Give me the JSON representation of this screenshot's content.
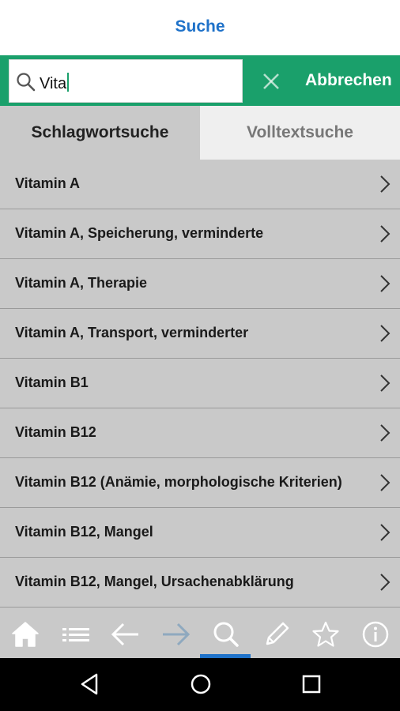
{
  "header": {
    "title": "Suche"
  },
  "search": {
    "value": "Vita",
    "clear_icon": "close-icon",
    "cancel_label": "Abbrechen"
  },
  "tabs": [
    {
      "label": "Schlagwortsuche",
      "active": true
    },
    {
      "label": "Volltextsuche",
      "active": false
    }
  ],
  "results": [
    {
      "label": "Vitamin A"
    },
    {
      "label": "Vitamin A, Speicherung, verminderte"
    },
    {
      "label": "Vitamin A, Therapie"
    },
    {
      "label": "Vitamin A, Transport, verminderter"
    },
    {
      "label": "Vitamin B1"
    },
    {
      "label": "Vitamin B12"
    },
    {
      "label": "Vitamin B12 (Anämie, morphologische Kriterien)"
    },
    {
      "label": "Vitamin B12, Mangel"
    },
    {
      "label": "Vitamin B12, Mangel, Ursachenabklärung"
    }
  ],
  "toolbar": {
    "items": [
      "home-icon",
      "list-icon",
      "back-arrow-icon",
      "forward-arrow-icon",
      "search-icon",
      "pencil-icon",
      "star-icon",
      "info-icon"
    ],
    "active": "search-icon"
  },
  "colors": {
    "accent_green": "#1aa06b",
    "accent_blue": "#1f72c9",
    "list_bg": "#c9c9c9"
  }
}
